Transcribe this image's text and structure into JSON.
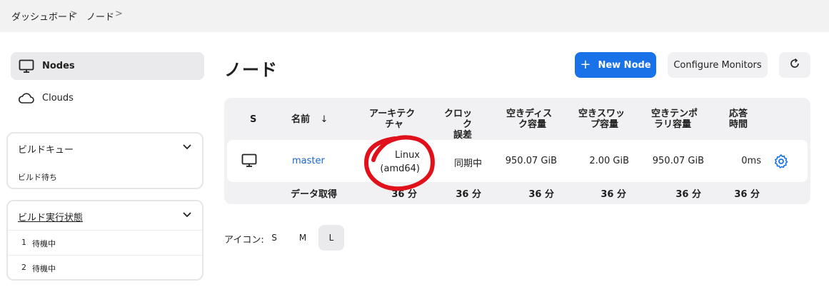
{
  "breadcrumb": [
    "ダッシュボード",
    "ノード"
  ],
  "sidebar": {
    "items": [
      {
        "label": "Nodes",
        "icon": "computer-icon",
        "active": true
      },
      {
        "label": "Clouds",
        "icon": "cloud-icon",
        "active": false
      }
    ]
  },
  "build_queue": {
    "title": "ビルドキュー",
    "empty_text": "ビルド待ち"
  },
  "executors": {
    "title": "ビルド実行状態",
    "rows": [
      {
        "num": "1",
        "status": "待機中"
      },
      {
        "num": "2",
        "status": "待機中"
      }
    ]
  },
  "main": {
    "title": "ノード",
    "new_node_label": "New Node",
    "configure_monitors_label": "Configure Monitors"
  },
  "table": {
    "headers": {
      "s": "S",
      "name": "名前",
      "sort_arrow": "↓",
      "arch_1": "アーキテク",
      "arch_2": "チャ",
      "clock_1": "クロック",
      "clock_2": "誤差",
      "disk_1": "空きディス",
      "disk_2": "ク容量",
      "swap_1": "空きスワッ",
      "swap_2": "プ容量",
      "temp_1": "空きテンポ",
      "temp_2": "ラリ容量",
      "resp_1": "応答",
      "resp_2": "時間"
    },
    "rows": [
      {
        "name": "master",
        "arch_1": "Linux",
        "arch_2": "(amd64)",
        "clock": "同期中",
        "disk": "950.07 GiB",
        "swap": "2.00 GiB",
        "temp": "950.07 GiB",
        "response": "0ms"
      }
    ],
    "footer": {
      "label": "データ取得",
      "arch": "36 分",
      "clock": "36 分",
      "disk": "36 分",
      "swap": "36 分",
      "temp": "36 分",
      "resp": "36 分"
    }
  },
  "icon_size": {
    "label": "アイコン:",
    "options": [
      "S",
      "M",
      "L"
    ],
    "selected": "L"
  },
  "colors": {
    "accent": "#1a72e8",
    "annotation": "#e0111a",
    "link": "#1a66c9"
  }
}
